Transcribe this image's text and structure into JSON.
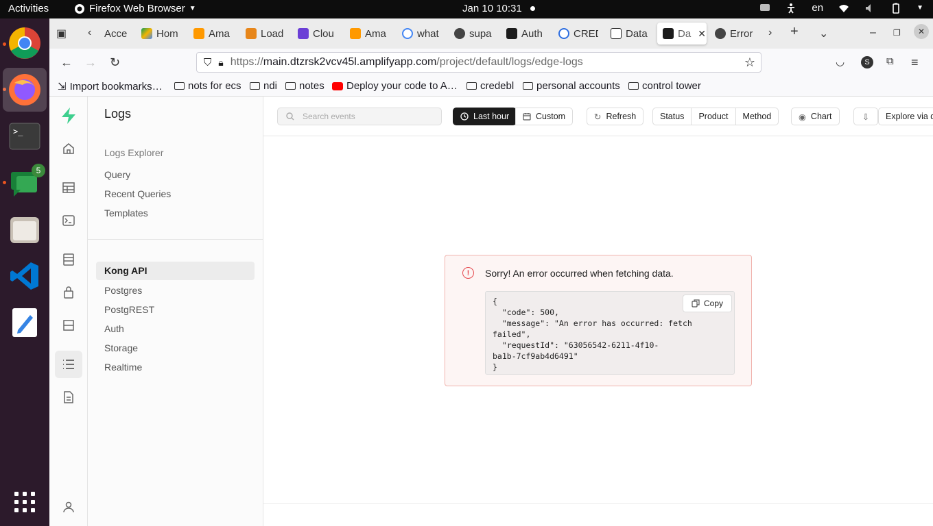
{
  "topbar": {
    "activities": "Activities",
    "app_name": "Firefox Web Browser",
    "clock": "Jan 10  10:31",
    "lang": "en"
  },
  "dock": {
    "items": [
      "chrome-icon",
      "firefox-icon",
      "terminal-icon",
      "google-chat-icon",
      "files-icon",
      "vscode-icon",
      "text-editor-icon",
      "app-grid-icon"
    ],
    "chat_badge": "5"
  },
  "tabs": [
    {
      "label": "Acce"
    },
    {
      "label": "Hom"
    },
    {
      "label": "Ama"
    },
    {
      "label": "Load"
    },
    {
      "label": "Clou"
    },
    {
      "label": "Ama"
    },
    {
      "label": "what"
    },
    {
      "label": "supa"
    },
    {
      "label": "Auth"
    },
    {
      "label": "CRED"
    },
    {
      "label": "Data"
    },
    {
      "label": "Da"
    },
    {
      "label": "Error"
    }
  ],
  "url": {
    "scheme": "https://",
    "host": "main.dtzrsk2vcv45l.amplifyapp.com",
    "path": "/project/default/logs/edge-logs"
  },
  "bookmarks": [
    {
      "label": "Import bookmarks…",
      "icon": "import-icon"
    },
    {
      "label": "nots for ecs",
      "icon": "folder-icon"
    },
    {
      "label": "ndi",
      "icon": "folder-icon"
    },
    {
      "label": "notes",
      "icon": "folder-icon"
    },
    {
      "label": "Deploy your code to A…",
      "icon": "youtube-icon"
    },
    {
      "label": "credebl",
      "icon": "folder-icon"
    },
    {
      "label": "personal accounts",
      "icon": "folder-icon"
    },
    {
      "label": "control tower",
      "icon": "folder-icon"
    }
  ],
  "menu": {
    "title": "Logs",
    "explorer_heading": "Logs Explorer",
    "explorer_items": [
      "Query",
      "Recent Queries",
      "Templates"
    ],
    "sources": [
      "Kong API",
      "Postgres",
      "PostgREST",
      "Auth",
      "Storage",
      "Realtime"
    ],
    "selected_source": "Kong API"
  },
  "toolbar": {
    "search_placeholder": "Search events",
    "last_hour": "Last hour",
    "custom": "Custom",
    "refresh": "Refresh",
    "filters": [
      "Status",
      "Product",
      "Method"
    ],
    "chart": "Chart",
    "explore": "Explore via q"
  },
  "error": {
    "message": "Sorry! An error occurred when fetching data.",
    "copy": "Copy",
    "json_lines": [
      "{",
      "  \"code\": 500,",
      "  \"message\": \"An error has occurred: fetch",
      "failed\",",
      "  \"requestId\": \"63056542-6211-4f10-",
      "ba1b-7cf9ab4d6491\"",
      "}"
    ]
  }
}
